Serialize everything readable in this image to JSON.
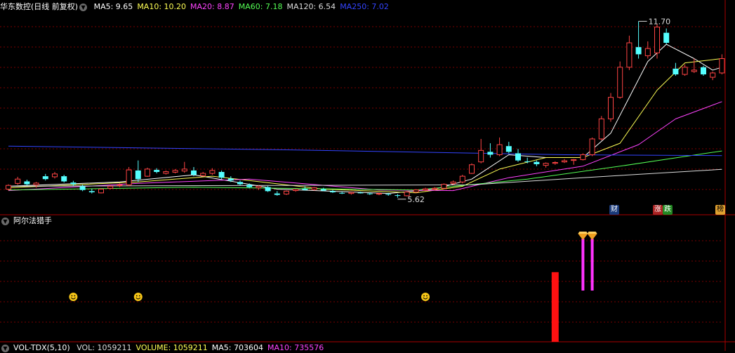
{
  "price_panel": {
    "stock_name": "华东数控",
    "mode": "(日线 前复权)",
    "ma_items": [
      {
        "label": "MA5: 9.65",
        "color": "#ffffff"
      },
      {
        "label": "MA10: 10.20",
        "color": "#ffff55"
      },
      {
        "label": "MA20: 8.87",
        "color": "#ff44ff"
      },
      {
        "label": "MA60: 7.18",
        "color": "#55ff55"
      },
      {
        "label": "MA120: 6.54",
        "color": "#dddddd"
      },
      {
        "label": "MA250: 7.02",
        "color": "#3344ff"
      }
    ],
    "high_label": "11.70",
    "low_label": "5.62",
    "badges": [
      {
        "text": "财",
        "color": "#ffffff",
        "bg": "#1a3a7a"
      },
      {
        "text": "涨",
        "color": "#ffffff",
        "bg": "#aa2222"
      },
      {
        "text": "跌",
        "color": "#ffffff",
        "bg": "#228822"
      },
      {
        "text": "榜",
        "color": "#000000",
        "bg": "#e0a030"
      }
    ]
  },
  "indicator_panel": {
    "title": "阿尔法猎手"
  },
  "volume_panel": {
    "title": "VOL-TDX(5,10)",
    "items": [
      {
        "label": "VOL: 1059211",
        "color": "#dddddd"
      },
      {
        "label": "VOLUME: 1059211",
        "color": "#ffff55"
      },
      {
        "label": "MA5: 703604",
        "color": "#ffffff"
      },
      {
        "label": "MA10: 735576",
        "color": "#ff44ff"
      }
    ]
  },
  "colors": {
    "up": "#ff4444",
    "down": "#55ffff",
    "grid": "#7a0000",
    "panel_border": "#aa0000"
  },
  "chart_data": [
    {
      "type": "candlestick",
      "title": "华东数控 日线 前复权",
      "note": "bars with o,h,l,c in price units; ma series in price units",
      "ylim": [
        5.3,
        12.1
      ],
      "candles": [
        [
          5.85,
          6.02,
          5.8,
          5.98
        ],
        [
          6.05,
          6.28,
          6.0,
          6.2
        ],
        [
          6.12,
          6.18,
          5.98,
          6.02
        ],
        [
          6.0,
          6.1,
          5.9,
          6.06
        ],
        [
          6.3,
          6.38,
          6.15,
          6.2
        ],
        [
          6.28,
          6.45,
          6.22,
          6.38
        ],
        [
          6.3,
          6.35,
          6.08,
          6.12
        ],
        [
          6.08,
          6.14,
          5.95,
          6.02
        ],
        [
          5.95,
          6.0,
          5.78,
          5.82
        ],
        [
          5.78,
          5.86,
          5.7,
          5.74
        ],
        [
          5.72,
          5.88,
          5.7,
          5.85
        ],
        [
          5.88,
          6.0,
          5.84,
          5.95
        ],
        [
          5.98,
          6.05,
          5.92,
          6.0
        ],
        [
          6.0,
          6.62,
          5.95,
          6.52
        ],
        [
          6.5,
          6.85,
          6.1,
          6.2
        ],
        [
          6.3,
          6.6,
          6.28,
          6.55
        ],
        [
          6.52,
          6.58,
          6.4,
          6.45
        ],
        [
          6.4,
          6.5,
          6.36,
          6.46
        ],
        [
          6.44,
          6.55,
          6.4,
          6.5
        ],
        [
          6.48,
          6.8,
          6.42,
          6.55
        ],
        [
          6.5,
          6.62,
          6.3,
          6.35
        ],
        [
          6.32,
          6.45,
          6.28,
          6.4
        ],
        [
          6.4,
          6.58,
          6.35,
          6.5
        ],
        [
          6.45,
          6.5,
          6.2,
          6.25
        ],
        [
          6.22,
          6.3,
          6.1,
          6.15
        ],
        [
          6.1,
          6.15,
          5.98,
          6.02
        ],
        [
          6.0,
          6.05,
          5.88,
          5.92
        ],
        [
          5.9,
          5.98,
          5.82,
          5.95
        ],
        [
          5.92,
          5.96,
          5.75,
          5.78
        ],
        [
          5.7,
          5.78,
          5.62,
          5.65
        ],
        [
          5.68,
          5.8,
          5.65,
          5.78
        ],
        [
          5.8,
          5.86,
          5.76,
          5.84
        ],
        [
          5.86,
          5.95,
          5.8,
          5.82
        ],
        [
          5.84,
          5.92,
          5.8,
          5.9
        ],
        [
          5.85,
          5.9,
          5.78,
          5.8
        ],
        [
          5.78,
          5.82,
          5.72,
          5.74
        ],
        [
          5.72,
          5.76,
          5.68,
          5.7
        ],
        [
          5.7,
          5.75,
          5.66,
          5.74
        ],
        [
          5.73,
          5.76,
          5.7,
          5.72
        ],
        [
          5.7,
          5.74,
          5.65,
          5.68
        ],
        [
          5.68,
          5.72,
          5.64,
          5.7
        ],
        [
          5.68,
          5.72,
          5.62,
          5.66
        ],
        [
          5.64,
          5.68,
          5.55,
          5.62
        ],
        [
          5.62,
          5.78,
          5.6,
          5.75
        ],
        [
          5.75,
          5.85,
          5.72,
          5.82
        ],
        [
          5.82,
          5.9,
          5.78,
          5.86
        ],
        [
          5.85,
          5.92,
          5.8,
          5.88
        ],
        [
          5.88,
          6.05,
          5.85,
          6.02
        ],
        [
          6.05,
          6.15,
          6.0,
          6.1
        ],
        [
          6.1,
          6.35,
          6.05,
          6.3
        ],
        [
          6.4,
          6.75,
          6.38,
          6.7
        ],
        [
          6.8,
          7.6,
          6.75,
          7.2
        ],
        [
          7.15,
          7.45,
          6.95,
          7.05
        ],
        [
          7.05,
          7.65,
          7.0,
          7.4
        ],
        [
          7.35,
          7.5,
          7.1,
          7.15
        ],
        [
          7.1,
          7.25,
          6.8,
          6.85
        ],
        [
          6.82,
          6.95,
          6.75,
          6.8
        ],
        [
          6.8,
          6.85,
          6.65,
          6.72
        ],
        [
          6.68,
          6.78,
          6.6,
          6.75
        ],
        [
          6.75,
          6.82,
          6.7,
          6.78
        ],
        [
          6.8,
          6.9,
          6.76,
          6.84
        ],
        [
          6.85,
          6.9,
          6.7,
          6.88
        ],
        [
          6.88,
          7.1,
          6.85,
          7.05
        ],
        [
          7.05,
          7.65,
          7.0,
          7.6
        ],
        [
          7.6,
          8.4,
          7.55,
          8.3
        ],
        [
          8.3,
          9.2,
          8.2,
          9.05
        ],
        [
          9.05,
          10.3,
          9.0,
          10.1
        ],
        [
          10.1,
          11.2,
          10.0,
          10.95
        ],
        [
          10.8,
          11.7,
          10.4,
          10.55
        ],
        [
          10.5,
          11.0,
          10.4,
          10.75
        ],
        [
          10.6,
          11.6,
          10.4,
          11.5
        ],
        [
          11.3,
          11.45,
          10.9,
          10.95
        ],
        [
          10.05,
          10.25,
          9.8,
          9.85
        ],
        [
          9.85,
          10.2,
          9.8,
          10.1
        ],
        [
          9.95,
          10.4,
          9.9,
          10.0
        ],
        [
          10.1,
          10.15,
          9.8,
          9.85
        ],
        [
          9.75,
          9.95,
          9.65,
          9.9
        ],
        [
          9.9,
          10.55,
          9.85,
          10.4
        ]
      ],
      "ma": {
        "MA5": [
          [
            0,
            5.95
          ],
          [
            12,
            6.1
          ],
          [
            20,
            6.35
          ],
          [
            29,
            5.85
          ],
          [
            41,
            5.7
          ],
          [
            46,
            5.85
          ],
          [
            50,
            6.2
          ],
          [
            54,
            7.05
          ],
          [
            58,
            6.95
          ],
          [
            62,
            6.95
          ],
          [
            65,
            7.8
          ],
          [
            69,
            10.3
          ],
          [
            71,
            10.9
          ],
          [
            74,
            10.4
          ],
          [
            76,
            10.0
          ],
          [
            77,
            10.1
          ]
        ],
        "MA10": [
          [
            0,
            5.9
          ],
          [
            14,
            6.1
          ],
          [
            22,
            6.3
          ],
          [
            34,
            5.85
          ],
          [
            44,
            5.72
          ],
          [
            49,
            5.95
          ],
          [
            53,
            6.55
          ],
          [
            58,
            6.95
          ],
          [
            62,
            6.95
          ],
          [
            66,
            7.45
          ],
          [
            70,
            9.3
          ],
          [
            73,
            10.25
          ],
          [
            77,
            10.4
          ]
        ],
        "MA20": [
          [
            0,
            5.8
          ],
          [
            14,
            6.05
          ],
          [
            26,
            6.2
          ],
          [
            40,
            5.82
          ],
          [
            48,
            5.8
          ],
          [
            54,
            6.25
          ],
          [
            62,
            6.65
          ],
          [
            68,
            7.4
          ],
          [
            72,
            8.3
          ],
          [
            77,
            8.9
          ]
        ],
        "MA60": [
          [
            0,
            5.82
          ],
          [
            20,
            5.92
          ],
          [
            44,
            5.82
          ],
          [
            56,
            6.2
          ],
          [
            66,
            6.65
          ],
          [
            77,
            7.18
          ]
        ],
        "MA120": [
          [
            0,
            5.95
          ],
          [
            30,
            5.98
          ],
          [
            50,
            6.0
          ],
          [
            62,
            6.25
          ],
          [
            77,
            6.54
          ]
        ],
        "MA250": [
          [
            0,
            7.35
          ],
          [
            30,
            7.22
          ],
          [
            60,
            7.05
          ],
          [
            77,
            7.02
          ]
        ]
      }
    },
    {
      "type": "bar",
      "title": "阿尔法猎手",
      "signals": [
        {
          "bar": 7,
          "kind": "smiley"
        },
        {
          "bar": 14,
          "kind": "smiley"
        },
        {
          "bar": 45,
          "kind": "smiley"
        },
        {
          "bar": 59,
          "kind": "red-bar",
          "value": 0.62
        },
        {
          "bar": 62,
          "kind": "magenta-bar-diamond",
          "value": 0.52
        },
        {
          "bar": 63,
          "kind": "magenta-bar-diamond",
          "value": 0.52
        }
      ]
    }
  ]
}
